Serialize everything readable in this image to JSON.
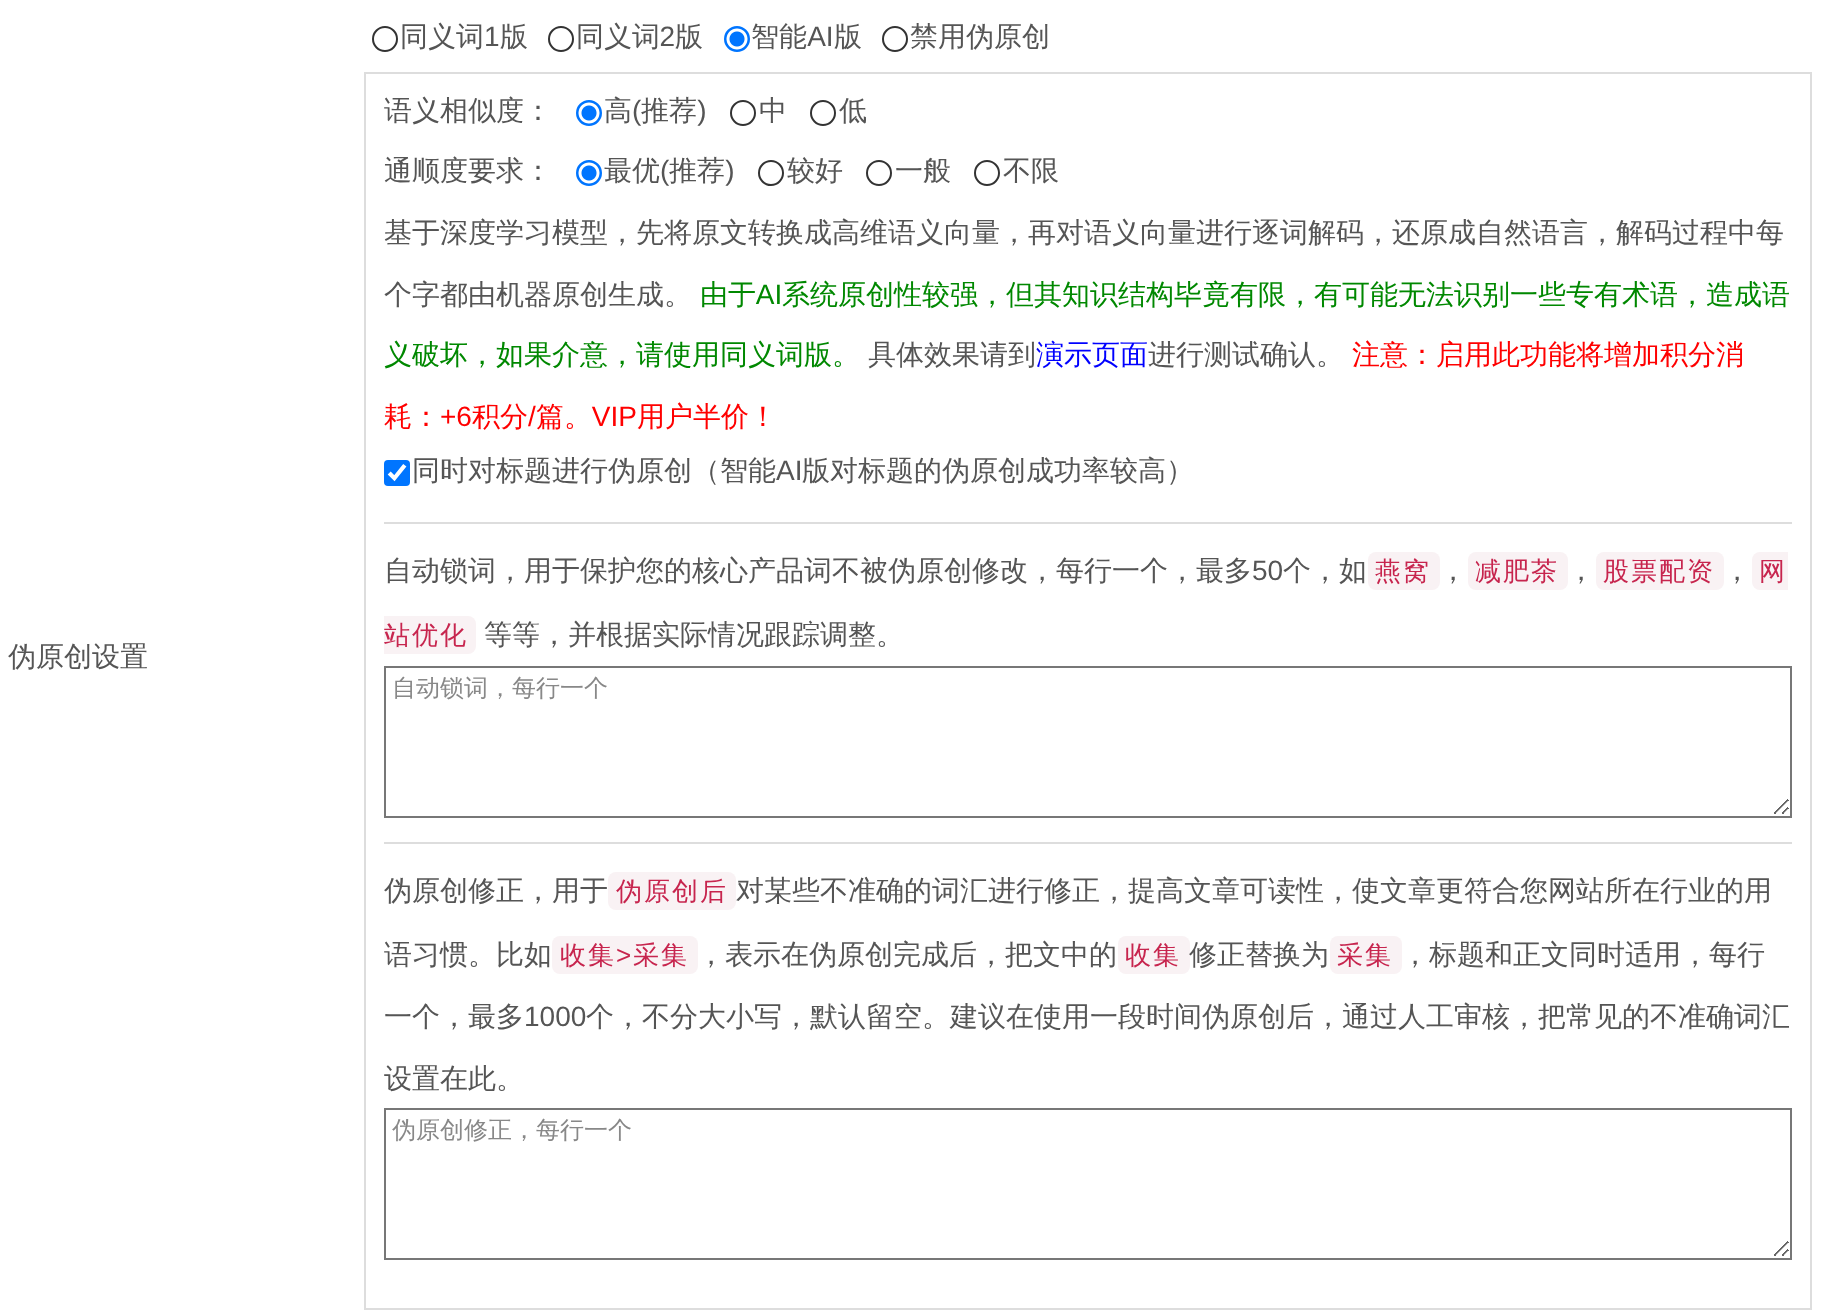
{
  "section_label": "伪原创设置",
  "mode_options": [
    {
      "label": "同义词1版",
      "selected": false
    },
    {
      "label": "同义词2版",
      "selected": false
    },
    {
      "label": "智能AI版",
      "selected": true
    },
    {
      "label": "禁用伪原创",
      "selected": false
    }
  ],
  "similarity": {
    "label": "语义相似度：",
    "options": [
      {
        "label": "高(推荐)",
        "selected": true
      },
      {
        "label": "中",
        "selected": false
      },
      {
        "label": "低",
        "selected": false
      }
    ]
  },
  "fluency": {
    "label": "通顺度要求：",
    "options": [
      {
        "label": "最优(推荐)",
        "selected": true
      },
      {
        "label": "较好",
        "selected": false
      },
      {
        "label": "一般",
        "selected": false
      },
      {
        "label": "不限",
        "selected": false
      }
    ]
  },
  "ai_description": [
    {
      "kind": "plain",
      "text": "基于深度学习模型，先将原文转换成高维语义向量，再对语义向量进行逐词解码，还原成自然语言，解码过程中每个字都由机器原创生成。 "
    },
    {
      "kind": "success",
      "text": "由于AI系统原创性较强，但其知识结构毕竟有限，有可能无法识别一些专有术语，造成语义破坏，如果介意，请使用同义词版。"
    },
    {
      "kind": "plain",
      "text": " 具体效果请到"
    },
    {
      "kind": "link",
      "text": "演示页面"
    },
    {
      "kind": "plain",
      "text": "进行测试确认。 "
    },
    {
      "kind": "warning",
      "text": "注意：启用此功能将增加积分消耗：+6积分/篇。VIP用户半价！"
    }
  ],
  "title_option": {
    "label": "同时对标题进行伪原创（智能AI版对标题的伪原创成功率较高）",
    "checked": true
  },
  "lock_words": {
    "description": [
      {
        "kind": "plain",
        "text": "自动锁词，用于保护您的核心产品词不被伪原创修改，每行一个，最多50个，如"
      },
      {
        "kind": "code",
        "text": "燕窝"
      },
      {
        "kind": "plain",
        "text": "，"
      },
      {
        "kind": "code",
        "text": "减肥茶"
      },
      {
        "kind": "plain",
        "text": "，"
      },
      {
        "kind": "code",
        "text": "股票配资"
      },
      {
        "kind": "plain",
        "text": "，"
      },
      {
        "kind": "code",
        "text": "网站优化"
      },
      {
        "kind": "plain",
        "text": " 等等，并根据实际情况跟踪调整。"
      }
    ],
    "placeholder": "自动锁词，每行一个"
  },
  "correction": {
    "description": [
      {
        "kind": "plain",
        "text": "伪原创修正，用于"
      },
      {
        "kind": "code",
        "text": "伪原创后"
      },
      {
        "kind": "plain",
        "text": "对某些不准确的词汇进行修正，提高文章可读性，使文章更符合您网站所在行业的用语习惯。比如"
      },
      {
        "kind": "code",
        "text": "收集>采集"
      },
      {
        "kind": "plain",
        "text": "，表示在伪原创完成后，把文中的"
      },
      {
        "kind": "code",
        "text": "收集"
      },
      {
        "kind": "plain",
        "text": "修正替换为"
      },
      {
        "kind": "code",
        "text": "采集"
      },
      {
        "kind": "plain",
        "text": "，标题和正文同时适用，每行一个，最多1000个，不分大小写，默认留空。建议在使用一段时间伪原创后，通过人工审核，把常见的不准确词汇设置在此。"
      }
    ],
    "placeholder": "伪原创修正，每行一个"
  }
}
